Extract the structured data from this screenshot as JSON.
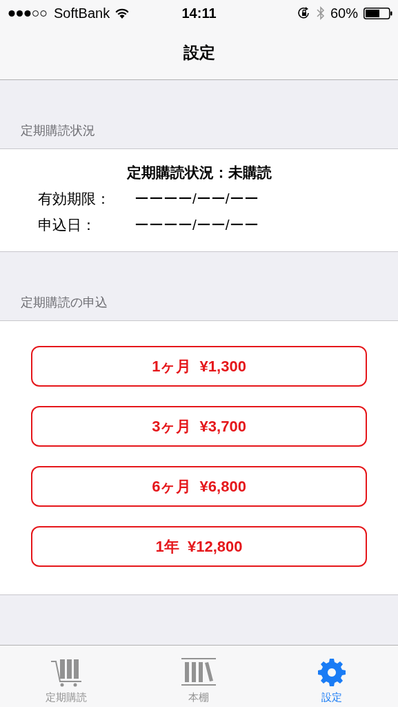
{
  "status_bar": {
    "carrier": "SoftBank",
    "time": "14:11",
    "battery": "60%"
  },
  "nav": {
    "title": "設定"
  },
  "sections": [
    {
      "header": "定期購読状況",
      "status": "定期購読状況：未購読",
      "rows": [
        {
          "label": "有効期限：",
          "value": "ーーーー/ーー/ーー"
        },
        {
          "label": "申込日：",
          "value": "ーーーー/ーー/ーー"
        }
      ]
    },
    {
      "header": "定期購読の申込",
      "buttons": [
        {
          "period": "1ヶ月",
          "price": "¥1,300"
        },
        {
          "period": "3ヶ月",
          "price": "¥3,700"
        },
        {
          "period": "6ヶ月",
          "price": "¥6,800"
        },
        {
          "period": "1年",
          "price": "¥12,800"
        }
      ]
    }
  ],
  "tabs": [
    {
      "label": "定期購読",
      "kind": "cart",
      "selected": false
    },
    {
      "label": "本棚",
      "kind": "shelf",
      "selected": false
    },
    {
      "label": "設定",
      "kind": "gear",
      "selected": true
    }
  ]
}
